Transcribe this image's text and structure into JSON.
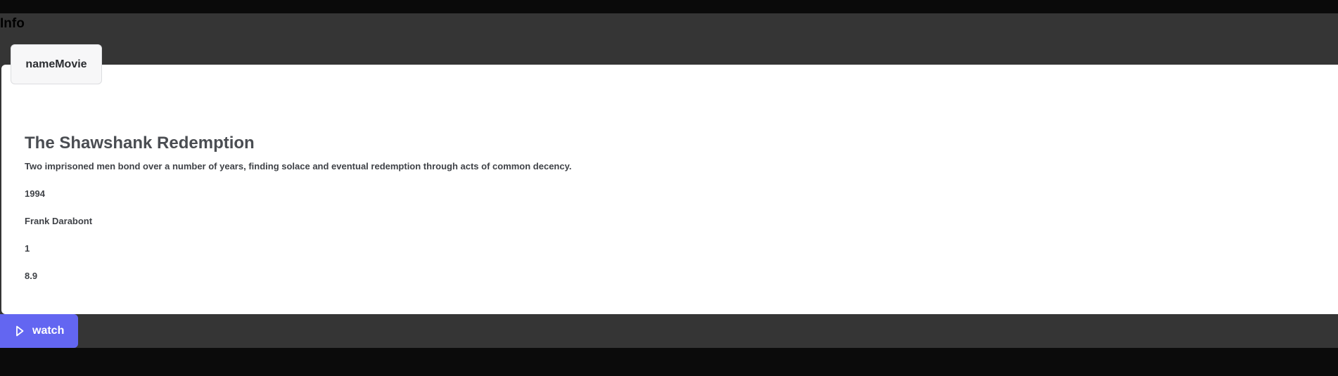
{
  "header": {
    "title": "Info"
  },
  "tab": {
    "label": "nameMovie"
  },
  "movie": {
    "title": "The Shawshank Redemption",
    "description": "Two imprisoned men bond over a number of years, finding solace and eventual redemption through acts of common decency.",
    "year": "1994",
    "director": "Frank Darabont",
    "rank": "1",
    "rating": "8.9"
  },
  "actions": {
    "watch_label": "watch",
    "watch_icon": "play-icon",
    "accent_color": "#6366f1"
  }
}
